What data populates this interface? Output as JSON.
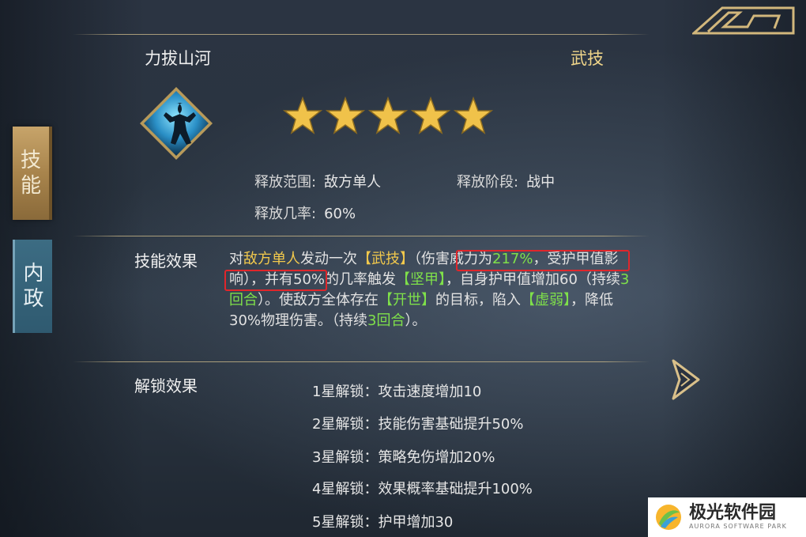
{
  "side_tabs": [
    {
      "label_line1": "技",
      "label_line2": "能",
      "active": true
    },
    {
      "label_line1": "内",
      "label_line2": "政",
      "active": false
    }
  ],
  "skill": {
    "name": "力拔山河",
    "type": "武技",
    "stars": 5,
    "range_label": "释放范围:",
    "range_value": "敌方单人",
    "phase_label": "释放阶段:",
    "phase_value": "战中",
    "chance_label": "释放几率:",
    "chance_value": "60%"
  },
  "effect": {
    "label": "技能效果",
    "segments": [
      {
        "text": "对",
        "style": "normal"
      },
      {
        "text": "敌方单人",
        "style": "yellow"
      },
      {
        "text": "发动一次",
        "style": "normal"
      },
      {
        "text": "【武技】",
        "style": "yellow"
      },
      {
        "text": "（伤害威力为",
        "style": "normal"
      },
      {
        "text": "217%",
        "style": "green"
      },
      {
        "text": "，受护甲值影响）",
        "style": "normal"
      },
      {
        "text": "，并有50%的几率触发",
        "style": "normal"
      },
      {
        "text": "【坚甲】",
        "style": "green"
      },
      {
        "text": "，自身护甲值增加60（持续",
        "style": "normal"
      },
      {
        "text": "3回合",
        "style": "green"
      },
      {
        "text": "）。使敌方全体存在",
        "style": "normal"
      },
      {
        "text": "【开世】",
        "style": "green"
      },
      {
        "text": "的目标，陷入",
        "style": "normal"
      },
      {
        "text": "【虚弱】",
        "style": "green"
      },
      {
        "text": "，降低30%物理伤害。（持续",
        "style": "normal"
      },
      {
        "text": "3回合",
        "style": "green"
      },
      {
        "text": "）。",
        "style": "normal"
      }
    ]
  },
  "unlock": {
    "label": "解锁效果",
    "items": [
      "1星解锁：攻击速度增加10",
      "2星解锁：技能伤害基础提升50%",
      "3星解锁：策略免伤增加20%",
      "4星解锁：效果概率基础提升100%",
      "5星解锁：护甲增加30"
    ]
  },
  "watermark": {
    "title": "极光软件园",
    "subtitle": "AURORA SOFTWARE PARK"
  },
  "icons": {
    "skill": "warrior-silhouette-icon",
    "star": "star-icon",
    "next": "arrow-right-icon",
    "corner": "ornament-icon"
  },
  "colors": {
    "highlight_yellow": "#f2c94c",
    "highlight_green": "#7fe04a",
    "annotation_red": "#e0262b",
    "star_gold": "#f0c24a"
  }
}
